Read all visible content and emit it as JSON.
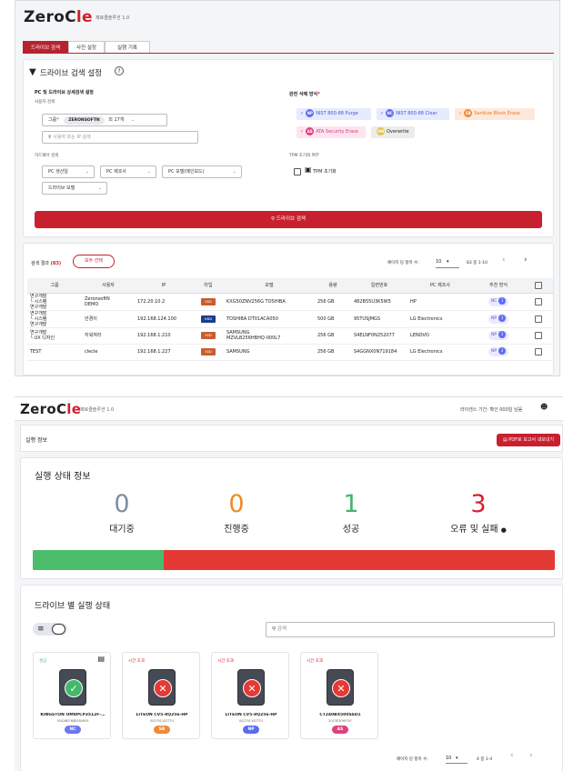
{
  "top": {
    "logo_pre": "ZeroC",
    "logo_le": "le",
    "version": "제로클솔루션 1.0",
    "tabs": [
      "드라이브 검색",
      "사전 설정",
      "실행 기록"
    ],
    "settings": {
      "title": "드라이브 검색 설정",
      "section_pc": "PC 및 드라이브 상세검색 설정",
      "user_search": "사용자 검색",
      "group_label": "그룹",
      "group_required": "*",
      "group_pill": "ZERONSOFTN",
      "group_more": "외 17개",
      "user_placeholder": "사용자 또는 IP 검색",
      "hw_search": "하드웨어 검색",
      "dropdowns": [
        "PC 생산일",
        "PC 제조사",
        "PC 모델(메인보드)",
        "드라이브 모델"
      ],
      "erase_title": "완전 삭제 방식",
      "erase_required": "*",
      "methods": [
        {
          "badge": "NP",
          "label": "NIST 800-88 Purge",
          "color": "#5d6cf0"
        },
        {
          "badge": "NC",
          "label": "NIST 800-88 Clear",
          "color": "#5d6cf0"
        },
        {
          "badge": "SB",
          "label": "Sanitize Block Erase",
          "color": "#f08a3a"
        },
        {
          "badge": "AS",
          "label": "ATA Security Erase",
          "color": "#e0407f"
        },
        {
          "badge": "OW",
          "label": "Overwrite",
          "color": "#e6c34a"
        }
      ],
      "tpm_title": "TPM 초기화 여부",
      "tpm_label": "TPM 초기화",
      "search_button": "드라이브 검색"
    },
    "results": {
      "label": "검색 결과",
      "count": "(83)",
      "select_all": "모두 선택",
      "per_page_label": "페이지 당 항목 수:",
      "per_page": "10",
      "range": "83 중 1-10",
      "columns": [
        "그룹",
        "사용자",
        "IP",
        "타입",
        "모델",
        "용량",
        "일련번호",
        "PC 제조사",
        "추천 방식"
      ],
      "rows": [
        {
          "group": "연구개발\n└ 시스템\n연구개발",
          "user": "ZeronsoftN\nDEMO",
          "ip": "172.20.10.2",
          "type": "SSD",
          "model": "KXG50ZNV256G TOSHIBA",
          "cap": "256 GB",
          "serial": "482B55U3K5W5",
          "maker": "HP",
          "rec": "NC",
          "num": "1"
        },
        {
          "group": "연구개발\n└ 시스템\n연구개발",
          "user": "안경이",
          "ip": "192.168.124.100",
          "type": "HDD",
          "model": "TOSHIBA DT01ACA050",
          "cap": "500 GB",
          "serial": "95TUSJMGS",
          "maker": "LG Electronics",
          "rec": "NP",
          "num": "3"
        },
        {
          "group": "연구개발\n└ UX 디자인",
          "user": "지워져라",
          "ip": "192.168.1.210",
          "type": "SSD",
          "model": "SAMSUNG\nMZVLB256HBHQ-000L7",
          "cap": "256 GB",
          "serial": "S4ELNF0N252077",
          "maker": "LENOVO",
          "rec": "NP",
          "num": "3"
        },
        {
          "group": "TEST",
          "user": "clecle",
          "ip": "192.168.1.227",
          "type": "SSD",
          "model": "SAMSUNG",
          "cap": "256 GB",
          "serial": "S4GGNX0N719184",
          "maker": "LG Electronics",
          "rec": "NP",
          "num": "3"
        }
      ]
    }
  },
  "bottom": {
    "logo_pre": "ZeroC",
    "logo_le": "le",
    "version": "제로클솔루션 1.0",
    "remaining": "라이센스 기간: 확인 000일 남음",
    "section": "실행 정보",
    "pdf_button": "PDF로 보고서 내보내기",
    "status_title": "실행 상태 정보",
    "stats": [
      {
        "value": "0",
        "label": "대기중",
        "color": "#7d8ea0"
      },
      {
        "value": "0",
        "label": "진행중",
        "color": "#f08a24"
      },
      {
        "value": "1",
        "label": "성공",
        "color": "#3fb76a"
      },
      {
        "value": "3",
        "label": "오류 및 실패",
        "color": "#d3202f"
      }
    ],
    "progress": {
      "success_fraction": 0.25
    },
    "drive_title": "드라이브 별 실행 상태",
    "search_placeholder": "검색",
    "drives": [
      {
        "status": "성공",
        "status_color": "#3fb76a",
        "result": "ok",
        "name": "KINGSTON OM8PCP3512F-…",
        "serial": "50026B768B1B0905",
        "badge": "NC",
        "badge_color": "#6b78f0"
      },
      {
        "status": "시간 초과",
        "status_color": "#d3202f",
        "result": "fail",
        "name": "LITEON CV5-8Q256-HP",
        "serial": "002701102TTU",
        "badge": "SB",
        "badge_color": "#f08a3a"
      },
      {
        "status": "시간 초과",
        "status_color": "#d3202f",
        "result": "fail",
        "name": "LITEON CV5-8Q256-HP",
        "serial": "002701102TTU",
        "badge": "NP",
        "badge_color": "#5d6cf0"
      },
      {
        "status": "시간 초과",
        "status_color": "#d3202f",
        "result": "fail",
        "name": "CT240BX500SSD1",
        "serial": "2013E3F96797",
        "badge": "AS",
        "badge_color": "#e0407f"
      }
    ],
    "per_page_label": "페이지 당 항목 수:",
    "per_page": "10",
    "range": "4 중 1-4"
  }
}
